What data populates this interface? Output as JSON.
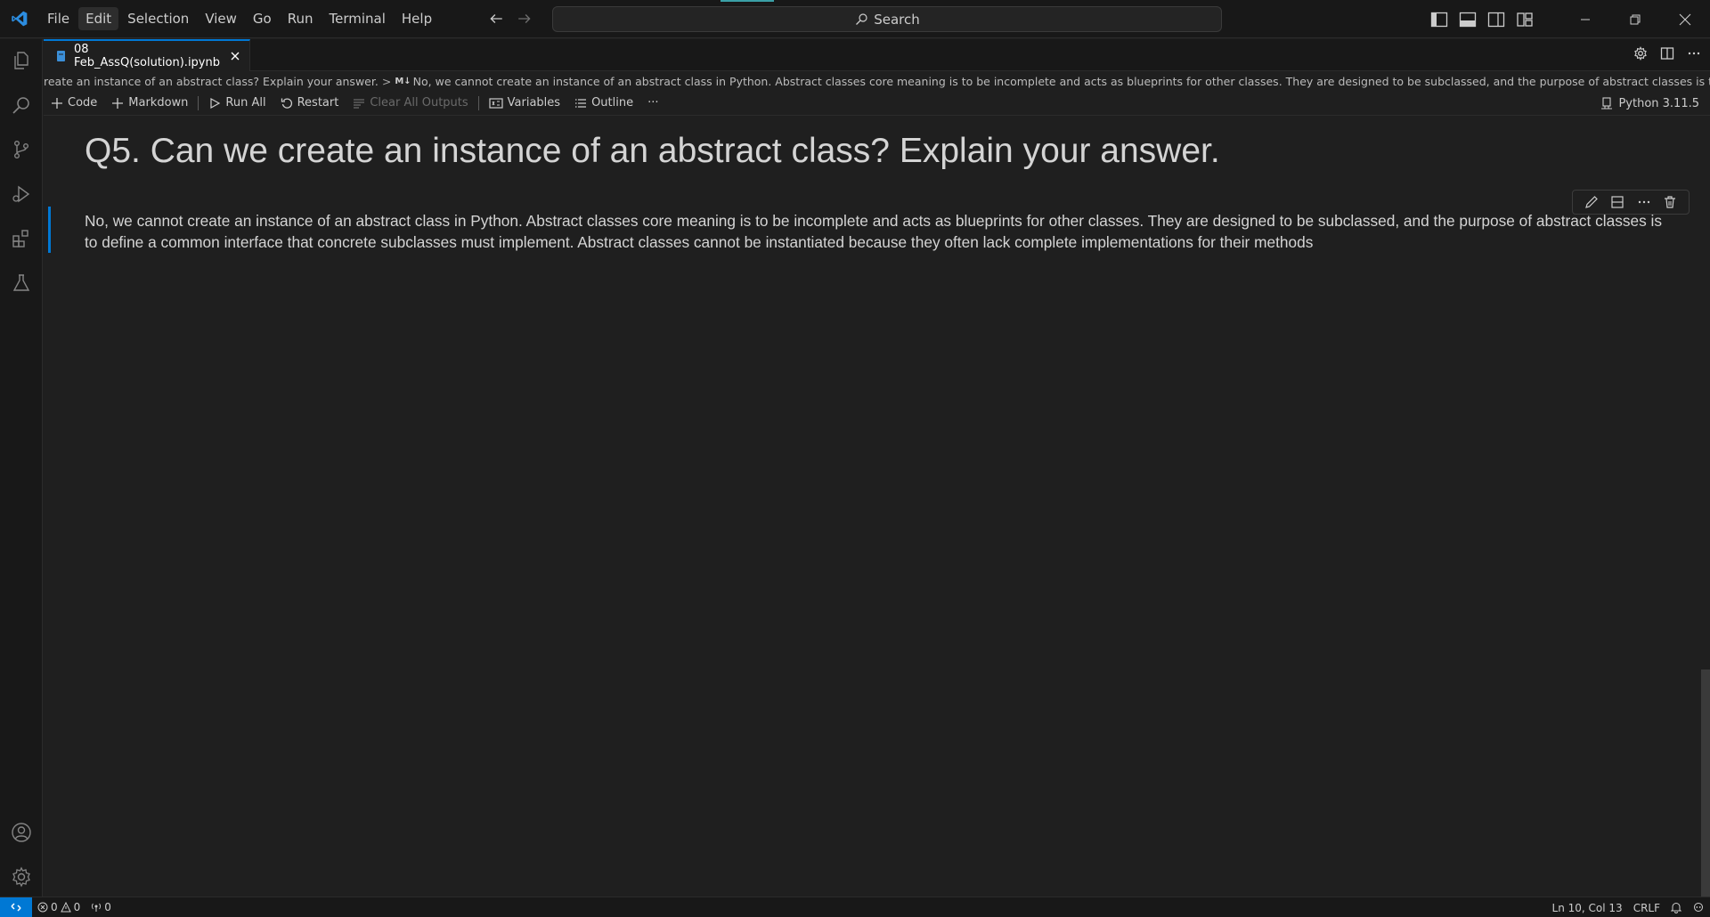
{
  "menu": [
    "File",
    "Edit",
    "Selection",
    "View",
    "Go",
    "Run",
    "Terminal",
    "Help"
  ],
  "menu_active": "Edit",
  "search": {
    "label": "Search"
  },
  "tab": {
    "title": "08 Feb_AssQ(solution).ipynb"
  },
  "breadcrumbs": {
    "first": "reate an instance of an abstract class? Explain your answer.",
    "md_badge": "M↓",
    "second": "No, we cannot create an instance of an abstract class in Python. Abstract classes core meaning is to be incomplete and acts as blueprints for other classes. They are designed to be subclassed, and the purpose of abstract classes is to define a com..."
  },
  "toolbar": {
    "code": "Code",
    "markdown": "Markdown",
    "run_all": "Run All",
    "restart": "Restart",
    "clear_outputs": "Clear All Outputs",
    "variables": "Variables",
    "outline": "Outline",
    "more": "···",
    "kernel": "Python 3.11.5"
  },
  "notebook": {
    "heading": "Q5. Can we create an instance of an abstract class? Explain your answer.",
    "answer": "No, we cannot create an instance of an abstract class in Python. Abstract classes core meaning is to be incomplete and acts as blueprints for other classes. They are designed to be subclassed, and the purpose of abstract classes is to define a common interface that concrete subclasses must implement. Abstract classes cannot be instantiated because they often lack complete implementations for their methods"
  },
  "statusbar": {
    "errors": "0",
    "warnings": "0",
    "ports": "0",
    "position": "Ln 10, Col 13",
    "eol": "CRLF"
  },
  "colors": {
    "accent": "#0078d4",
    "background": "#1f1f1f",
    "chrome": "#181818"
  }
}
